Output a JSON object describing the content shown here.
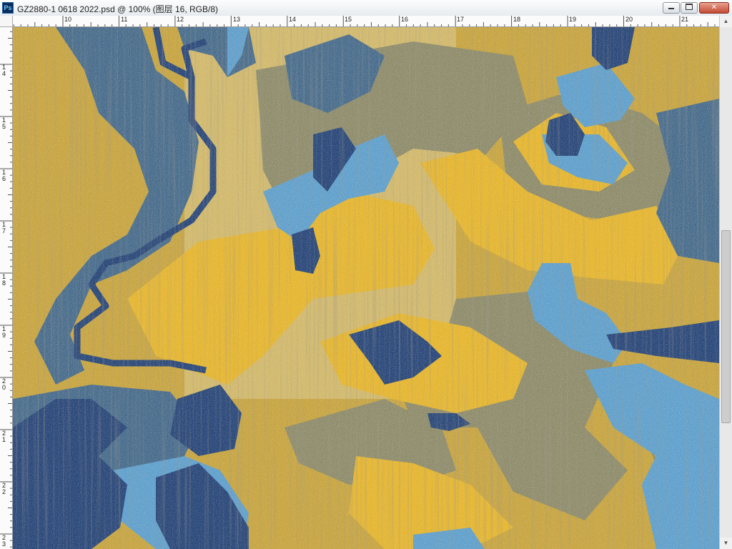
{
  "window": {
    "app_icon": "photoshop-icon",
    "app_icon_text": "Ps",
    "title": "GZ2880-1 0618 2022.psd @ 100% (图层 16, RGB/8)",
    "buttons": {
      "minimize": "minimize-icon",
      "maximize": "maximize-icon",
      "close": "close-icon",
      "close_glyph": "✕"
    }
  },
  "rulers": {
    "horizontal": [
      "10",
      "11",
      "12",
      "13",
      "14",
      "15",
      "16",
      "17",
      "18",
      "19",
      "20",
      "21"
    ],
    "vertical": [
      "14",
      "15",
      "16",
      "17",
      "18",
      "19",
      "20",
      "21",
      "22",
      "23"
    ]
  },
  "scrollbar": {
    "up_arrow": "▲",
    "down_arrow": "▼"
  },
  "canvas": {
    "content": "camouflage-pattern-artwork",
    "colors": {
      "navy": "#27467a",
      "slate_blue": "#466a8c",
      "sky_blue": "#5fa0cf",
      "mustard": "#e6b52d",
      "gold_speckle": "#caa53d",
      "olive_gray": "#8c8c6c",
      "pale_speckle": "#d9c98c"
    }
  }
}
